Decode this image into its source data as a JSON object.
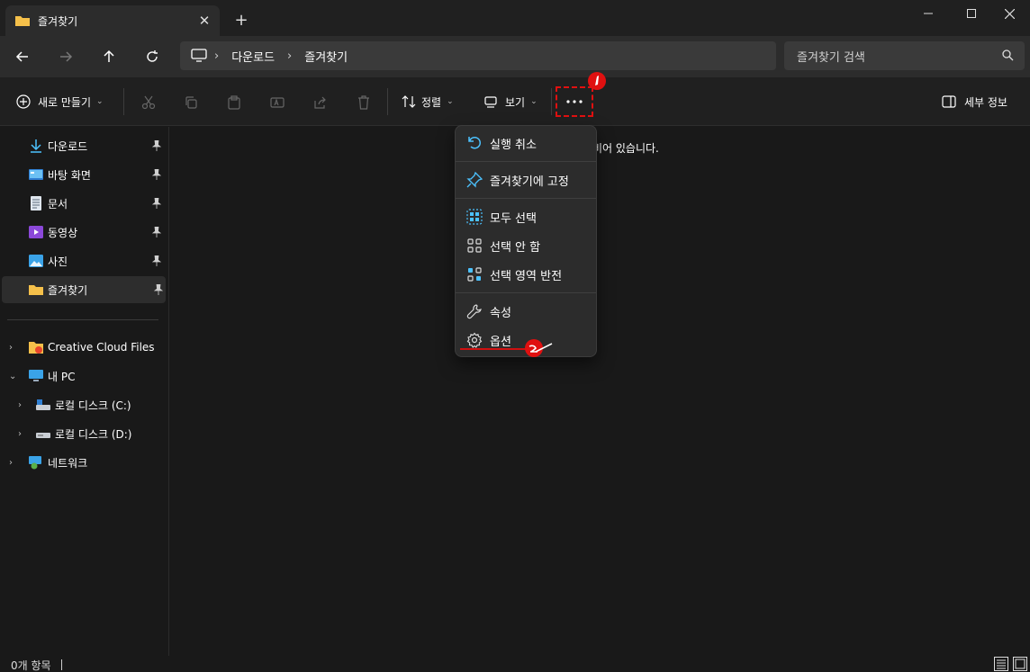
{
  "window": {
    "tab_title": "즐겨찾기"
  },
  "nav": {
    "breadcrumb": [
      "다운로드",
      "즐겨찾기"
    ],
    "search_placeholder": "즐겨찾기 검색"
  },
  "toolbar": {
    "new_label": "새로 만들기",
    "sort_label": "정렬",
    "view_label": "보기",
    "details_label": "세부 정보"
  },
  "sidebar": {
    "quick_access": [
      {
        "label": "다운로드",
        "icon": "download-icon",
        "pinned": true
      },
      {
        "label": "바탕 화면",
        "icon": "desktop-icon",
        "pinned": true
      },
      {
        "label": "문서",
        "icon": "document-icon",
        "pinned": true
      },
      {
        "label": "동영상",
        "icon": "video-icon",
        "pinned": true
      },
      {
        "label": "사진",
        "icon": "picture-icon",
        "pinned": true
      },
      {
        "label": "즐겨찾기",
        "icon": "folder-icon",
        "pinned": true
      }
    ],
    "tree": [
      {
        "label": "Creative Cloud Files",
        "icon": "creative-cloud-icon"
      },
      {
        "label": "내 PC",
        "icon": "pc-icon"
      },
      {
        "label": "로컬 디스크 (C:)",
        "icon": "drive-icon"
      },
      {
        "label": "로컬 디스크 (D:)",
        "icon": "drive-icon"
      },
      {
        "label": "네트워크",
        "icon": "network-icon"
      }
    ]
  },
  "content": {
    "empty_message": "비어 있습니다."
  },
  "context_menu": {
    "items": [
      {
        "label": "실행 취소",
        "icon": "undo-icon"
      },
      {
        "label": "즐겨찾기에 고정",
        "icon": "pin-icon"
      },
      {
        "label": "모두 선택",
        "icon": "select-all-icon"
      },
      {
        "label": "선택 안 함",
        "icon": "select-none-icon"
      },
      {
        "label": "선택 영역 반전",
        "icon": "invert-selection-icon"
      },
      {
        "label": "속성",
        "icon": "wrench-icon"
      },
      {
        "label": "옵션",
        "icon": "gear-icon"
      }
    ]
  },
  "status": {
    "item_count": "0개 항목"
  },
  "colors": {
    "annotation": "#e01010",
    "accent": "#4cc2ff",
    "folder": "#f5c04a"
  }
}
